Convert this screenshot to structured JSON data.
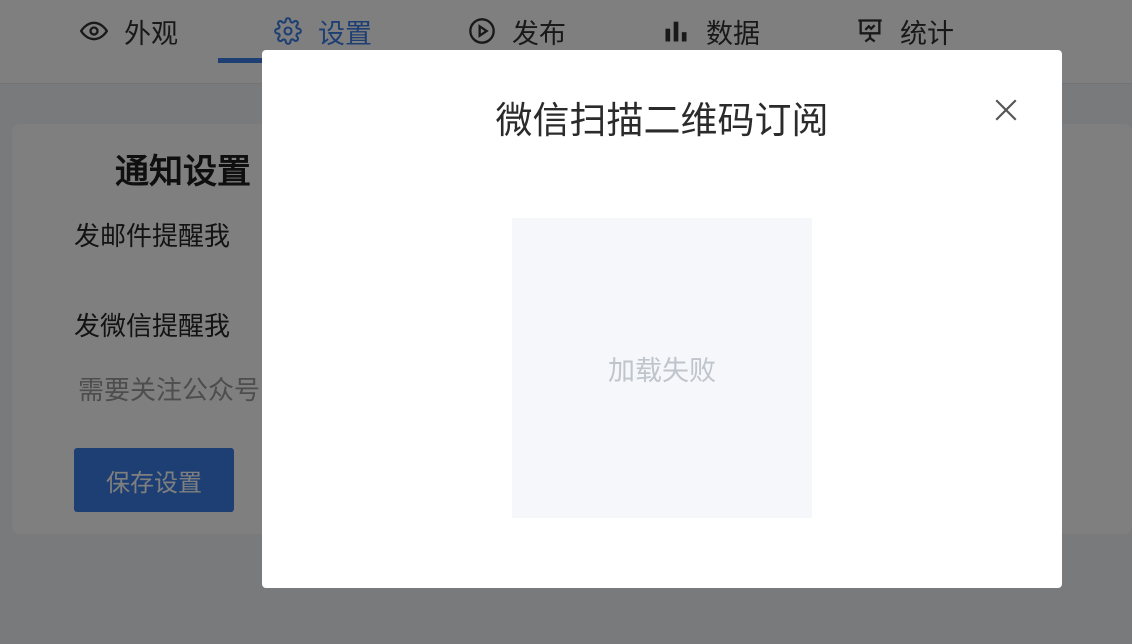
{
  "nav": {
    "items": [
      {
        "label": "外观",
        "icon": "eye-icon"
      },
      {
        "label": "设置",
        "icon": "gear-icon",
        "active": true
      },
      {
        "label": "发布",
        "icon": "play-circle-icon"
      },
      {
        "label": "数据",
        "icon": "bar-chart-icon"
      },
      {
        "label": "统计",
        "icon": "presentation-chart-icon"
      }
    ]
  },
  "settings": {
    "title": "通知设置",
    "email_label": "发邮件提醒我",
    "wechat_label": "发微信提醒我",
    "wechat_hint": "需要关注公众号",
    "save_label": "保存设置"
  },
  "modal": {
    "title": "微信扫描二维码订阅",
    "qr_error": "加载失败",
    "close_icon": "close-icon"
  },
  "colors": {
    "accent": "#3d7fe6",
    "overlay": "rgba(0,0,0,0.5)",
    "placeholder_bg": "#f5f7fa"
  }
}
